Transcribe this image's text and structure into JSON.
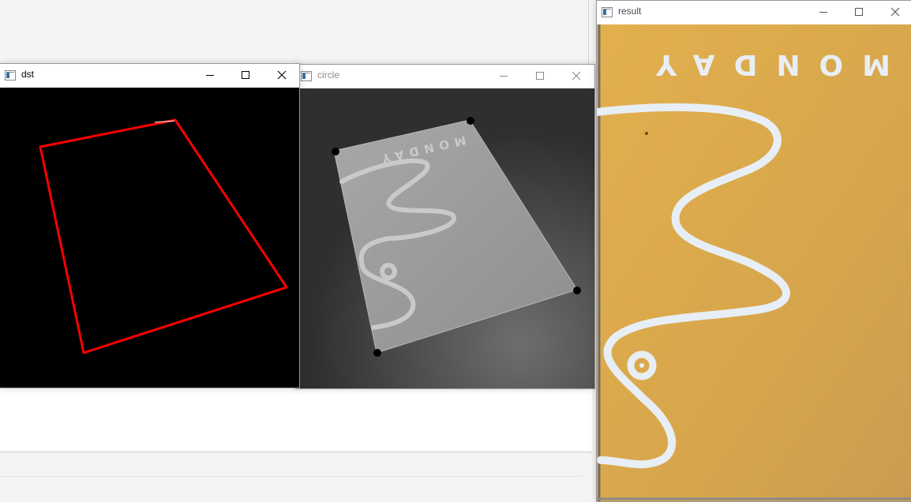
{
  "windows": {
    "dst": {
      "title": "dst",
      "background": "#000000",
      "outline_color": "#ff0000"
    },
    "circle": {
      "title": "circle",
      "background": "#3c3c3c",
      "card_color": "#9c9c9c",
      "corner_marker_color": "#000000"
    },
    "result": {
      "title": "result",
      "card_color": "#d9a94a",
      "pattern_color": "#e8eef5"
    }
  },
  "card_text": "MONDAY",
  "title_controls": {
    "minimize_icon": "minimize-icon",
    "maximize_icon": "maximize-icon",
    "close_icon": "close-icon"
  }
}
